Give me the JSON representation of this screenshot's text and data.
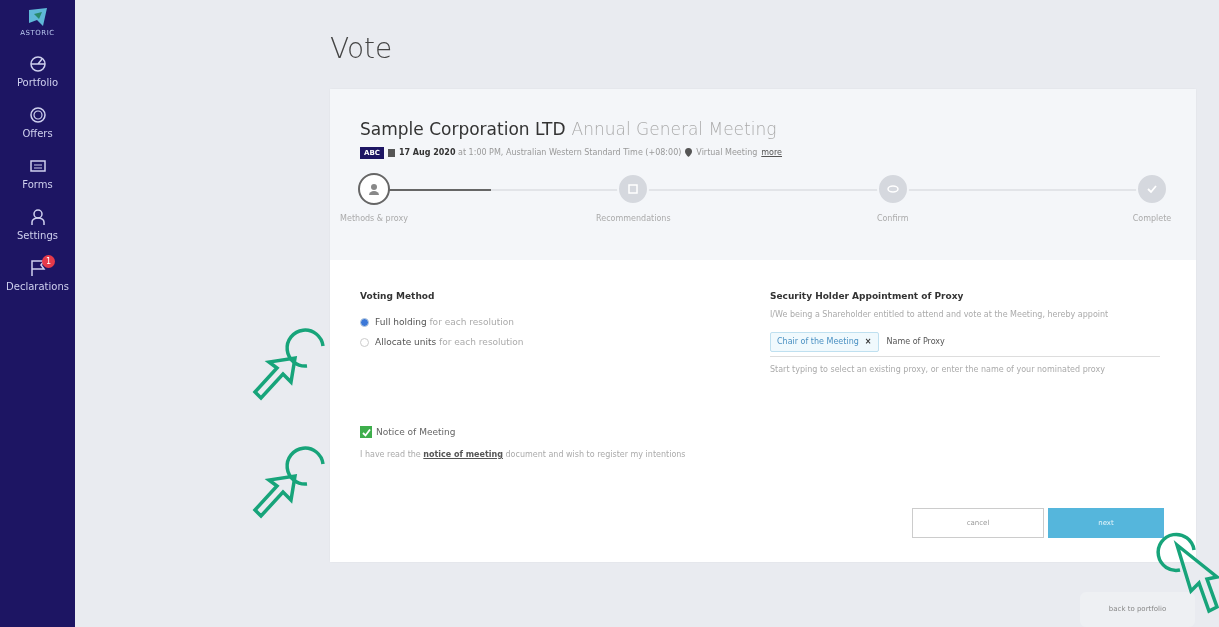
{
  "sidebar": {
    "logo_text": "ASTORIC",
    "items": [
      {
        "label": "Portfolio"
      },
      {
        "label": "Offers"
      },
      {
        "label": "Forms"
      },
      {
        "label": "Settings"
      },
      {
        "label": "Declarations",
        "badge": "1"
      }
    ]
  },
  "page_title": "Vote",
  "meeting": {
    "company": "Sample Corporation LTD",
    "type": "Annual General Meeting",
    "code": "ABC",
    "date": "17 Aug 2020",
    "time": "at 1:00 PM, Australian Western Standard Time (+08:00)",
    "location": "Virtual Meeting",
    "location_link": "more"
  },
  "stepper": {
    "level": 0.15,
    "steps": [
      {
        "label": "Methods & proxy",
        "selected": true
      },
      {
        "label": "Recommendations",
        "selected": false
      },
      {
        "label": "Confirm",
        "selected": false
      },
      {
        "label": "Complete",
        "selected": false
      }
    ]
  },
  "voting_method": {
    "title": "Voting Method",
    "options": [
      {
        "bold": "Full holding",
        "rest": "for each resolution",
        "selected": true
      },
      {
        "bold": "Allocate units",
        "rest": "for each resolution",
        "selected": false
      }
    ]
  },
  "notice": {
    "label": "Notice of Meeting",
    "checked": true,
    "text_before": "I have read the",
    "link": "notice of meeting",
    "text_after": "document and wish to register my intentions"
  },
  "proxy": {
    "title": "Security Holder Appointment of Proxy",
    "description": "I/We being a Shareholder entitled to attend and vote at the Meeting, hereby appoint",
    "tag": "Chair of the Meeting",
    "tag_remove": "×",
    "placeholder": "Name of Proxy",
    "help": "Start typing to select an existing proxy, or enter the name of your nominated proxy"
  },
  "buttons": [
    {
      "label": "cancel",
      "kind": "outline"
    },
    {
      "label": "next",
      "kind": "primary"
    }
  ],
  "back_button": "back to portfolio"
}
